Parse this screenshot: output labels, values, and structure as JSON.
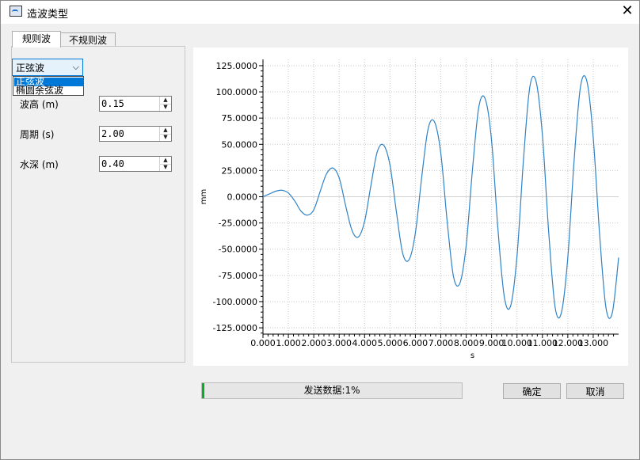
{
  "window": {
    "title": "造波类型",
    "close_label": "✕"
  },
  "tabs": [
    {
      "label": "规则波",
      "active": true
    },
    {
      "label": "不规则波",
      "active": false
    }
  ],
  "wave_type": {
    "selected": "正弦波",
    "arrow": "⌵",
    "options": [
      "正弦波",
      "椭圆余弦波"
    ],
    "highlighted": "正弦波"
  },
  "fields": [
    {
      "label": "波高 (m)",
      "value": "0.15"
    },
    {
      "label": "周期 (s)",
      "value": "2.00"
    },
    {
      "label": "水深 (m)",
      "value": "0.40"
    }
  ],
  "spin_arrows": {
    "up": "▲",
    "down": "▼"
  },
  "progress": {
    "text": "发送数据:1%",
    "value": 0.01
  },
  "buttons": {
    "ok": "确定",
    "cancel": "取消"
  },
  "chart_data": {
    "type": "line",
    "xlabel": "s",
    "ylabel": "mm",
    "xlim": [
      0,
      14
    ],
    "ylim": [
      -131,
      131
    ],
    "grid": true,
    "series_color": "#2f82c6",
    "xticks": [
      {
        "value": 0,
        "label": "0.000"
      },
      {
        "value": 1,
        "label": "1.000"
      },
      {
        "value": 2,
        "label": "2.000"
      },
      {
        "value": 3,
        "label": "3.000"
      },
      {
        "value": 4,
        "label": "4.000"
      },
      {
        "value": 5,
        "label": "5.000"
      },
      {
        "value": 6,
        "label": "6.000"
      },
      {
        "value": 7,
        "label": "7.000"
      },
      {
        "value": 8,
        "label": "8.000"
      },
      {
        "value": 9,
        "label": "9.000"
      },
      {
        "value": 10,
        "label": "10.000"
      },
      {
        "value": 11,
        "label": "11.000"
      },
      {
        "value": 12,
        "label": "12.000"
      },
      {
        "value": 13,
        "label": "13.000"
      }
    ],
    "yticks": [
      {
        "value": 125,
        "label": "125.0000"
      },
      {
        "value": 100,
        "label": "100.0000"
      },
      {
        "value": 75,
        "label": "75.0000"
      },
      {
        "value": 50,
        "label": "50.0000"
      },
      {
        "value": 25,
        "label": "25.0000"
      },
      {
        "value": 0,
        "label": "0.0000"
      },
      {
        "value": -25,
        "label": "-25.0000"
      },
      {
        "value": -50,
        "label": "-50.0000"
      },
      {
        "value": -75,
        "label": "-75.0000"
      },
      {
        "value": -100,
        "label": "-100.0000"
      },
      {
        "value": -125,
        "label": "-125.0000"
      }
    ],
    "x": [
      0,
      0.25,
      0.5,
      0.75,
      1,
      1.25,
      1.5,
      1.75,
      2,
      2.25,
      2.5,
      2.75,
      3,
      3.25,
      3.5,
      3.75,
      4,
      4.25,
      4.5,
      4.75,
      5,
      5.25,
      5.5,
      5.75,
      6,
      6.25,
      6.5,
      6.75,
      7,
      7.25,
      7.5,
      7.75,
      8,
      8.25,
      8.5,
      8.75,
      9,
      9.25,
      9.5,
      9.75,
      10,
      10.25,
      10.5,
      10.75,
      11,
      11.25,
      11.5,
      11.75,
      12,
      12.25,
      12.5,
      12.75,
      13,
      13.25,
      13.5,
      13.75,
      14
    ],
    "y": [
      0,
      2.6,
      5.3,
      6.2,
      3.6,
      -4,
      -13.8,
      -17.5,
      -12.5,
      5,
      21.8,
      27.4,
      18,
      -8,
      -31.9,
      -38.4,
      -23.5,
      10.9,
      42.9,
      49.2,
      30.1,
      -14,
      -54,
      -60.1,
      -34.5,
      18.6,
      64.8,
      71.5,
      41.6,
      -23.1,
      -76,
      -82.5,
      -46.3,
      26.8,
      86,
      93.2,
      53.5,
      -31.2,
      -95.6,
      -104,
      -56.7,
      33.6,
      104.2,
      110,
      58.8,
      -34.5,
      -105.2,
      -110.4,
      -57.7,
      35.3,
      105,
      110.2,
      56.8,
      -35,
      -105.6,
      -110.8,
      -58
    ]
  }
}
